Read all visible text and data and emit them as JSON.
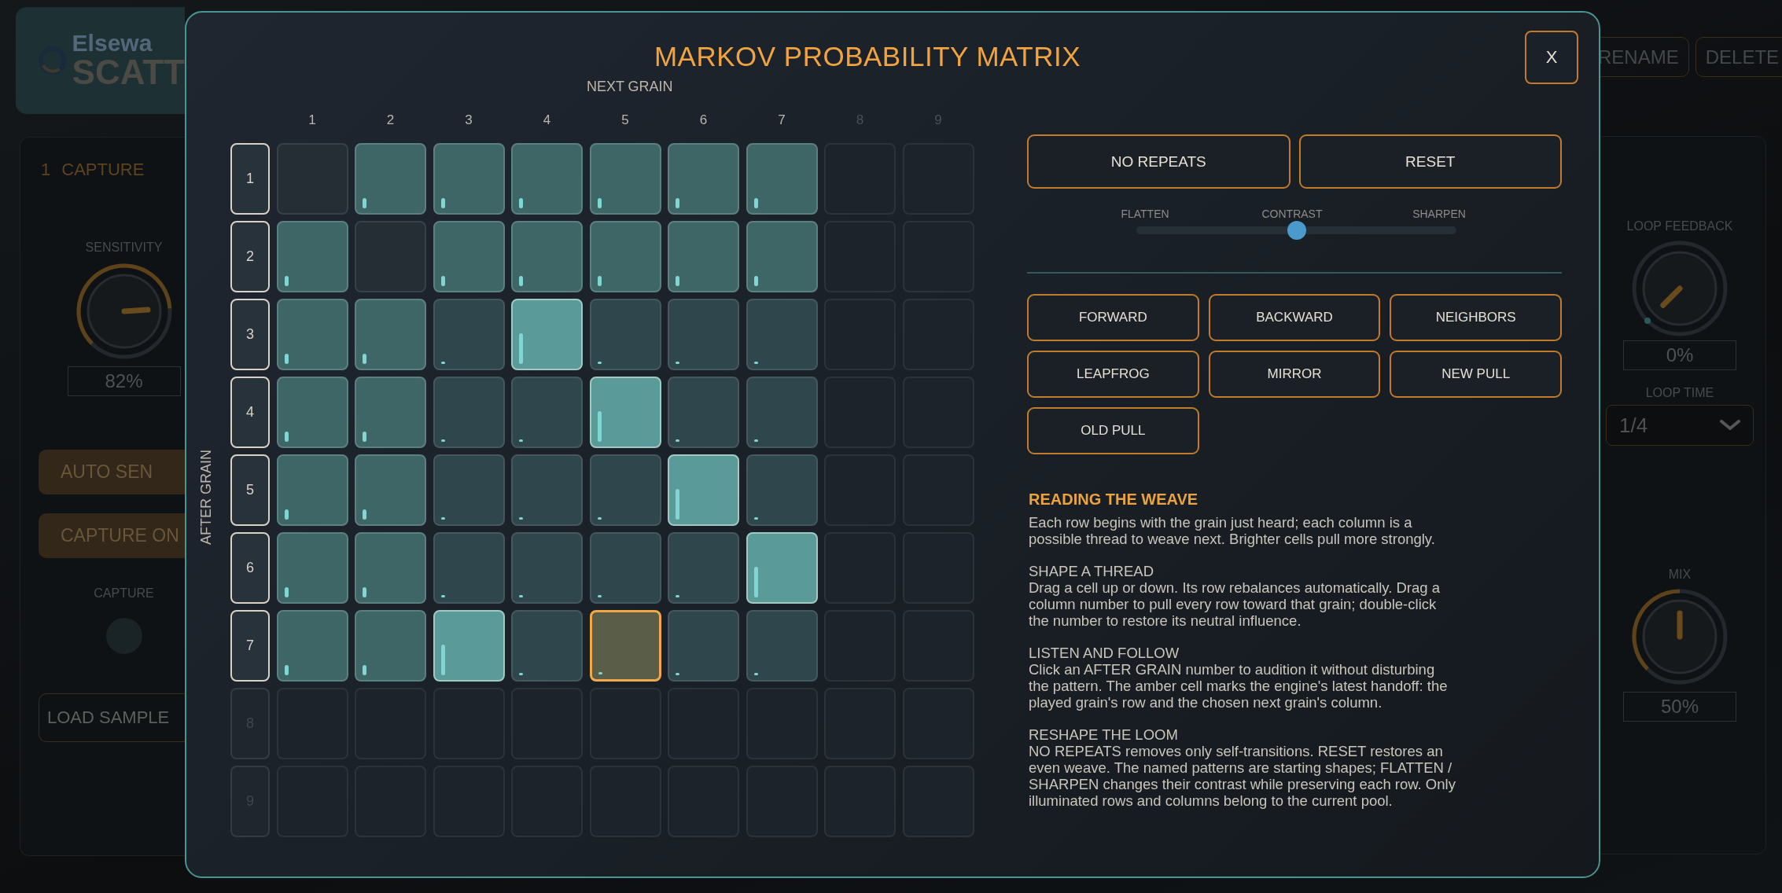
{
  "background_app": {
    "logo": {
      "line_1": "Elsewa",
      "line_2": "SCATT"
    },
    "capture_panel": {
      "number": "1",
      "title": "CAPTURE",
      "sensitivity": {
        "label": "SENSITIVITY",
        "reading": "82%"
      },
      "buttons": [
        "AUTO SEN",
        "CAPTURE ON"
      ],
      "indicator": {
        "label": "CAPTURE",
        "on": false
      },
      "load_button": "LOAD SAMPLE"
    },
    "header_buttons": [
      "RENAME",
      "DELETE"
    ],
    "loop_panel": {
      "loop_feedback": {
        "label": "LOOP FEEDBACK",
        "reading": "0%"
      },
      "loop_time": {
        "label": "LOOP TIME",
        "value": "1/4"
      },
      "mix": {
        "label": "MIX",
        "reading": "50%"
      }
    }
  },
  "modal": {
    "title": "MARKOV PROBABILITY MATRIX",
    "close": "X",
    "x_axis_label": "NEXT GRAIN",
    "y_axis_label": "AFTER GRAIN",
    "columns": [
      {
        "label": "1",
        "active": true
      },
      {
        "label": "2",
        "active": true
      },
      {
        "label": "3",
        "active": true
      },
      {
        "label": "4",
        "active": true
      },
      {
        "label": "5",
        "active": true
      },
      {
        "label": "6",
        "active": true
      },
      {
        "label": "7",
        "active": true
      },
      {
        "label": "8",
        "active": false
      },
      {
        "label": "9",
        "active": false
      }
    ],
    "rows": [
      {
        "label": "1",
        "active": true,
        "cells": [
          {
            "kind": "none",
            "selected": false
          },
          {
            "kind": "medium",
            "selected": false
          },
          {
            "kind": "medium",
            "selected": false
          },
          {
            "kind": "medium",
            "selected": false
          },
          {
            "kind": "medium",
            "selected": false
          },
          {
            "kind": "medium",
            "selected": false
          },
          {
            "kind": "medium",
            "selected": false
          },
          {
            "selected": false
          },
          {
            "selected": false
          }
        ]
      },
      {
        "label": "2",
        "active": true,
        "cells": [
          {
            "kind": "medium",
            "selected": false
          },
          {
            "kind": "none",
            "selected": false
          },
          {
            "kind": "medium",
            "selected": false
          },
          {
            "kind": "medium",
            "selected": false
          },
          {
            "kind": "medium",
            "selected": false
          },
          {
            "kind": "medium",
            "selected": false
          },
          {
            "kind": "medium",
            "selected": false
          },
          {
            "selected": false
          },
          {
            "selected": false
          }
        ]
      },
      {
        "label": "3",
        "active": true,
        "cells": [
          {
            "kind": "medium",
            "selected": false
          },
          {
            "kind": "medium",
            "selected": false
          },
          {
            "kind": "weak",
            "selected": false
          },
          {
            "kind": "strong",
            "selected": false
          },
          {
            "kind": "weak",
            "selected": false
          },
          {
            "kind": "weak",
            "selected": false
          },
          {
            "kind": "weak",
            "selected": false
          },
          {
            "selected": false
          },
          {
            "selected": false
          }
        ]
      },
      {
        "label": "4",
        "active": true,
        "cells": [
          {
            "kind": "medium",
            "selected": false
          },
          {
            "kind": "medium",
            "selected": false
          },
          {
            "kind": "weak",
            "selected": false
          },
          {
            "kind": "weak",
            "selected": false
          },
          {
            "kind": "strong",
            "selected": false
          },
          {
            "kind": "weak",
            "selected": false
          },
          {
            "kind": "weak",
            "selected": false
          },
          {
            "selected": false
          },
          {
            "selected": false
          }
        ]
      },
      {
        "label": "5",
        "active": true,
        "cells": [
          {
            "kind": "medium",
            "selected": false
          },
          {
            "kind": "medium",
            "selected": false
          },
          {
            "kind": "weak",
            "selected": false
          },
          {
            "kind": "weak",
            "selected": false
          },
          {
            "kind": "weak",
            "selected": false
          },
          {
            "kind": "strong",
            "selected": false
          },
          {
            "kind": "weak",
            "selected": false
          },
          {
            "selected": false
          },
          {
            "selected": false
          }
        ]
      },
      {
        "label": "6",
        "active": true,
        "cells": [
          {
            "kind": "medium",
            "selected": false
          },
          {
            "kind": "medium",
            "selected": false
          },
          {
            "kind": "weak",
            "selected": false
          },
          {
            "kind": "weak",
            "selected": false
          },
          {
            "kind": "weak",
            "selected": false
          },
          {
            "kind": "weak",
            "selected": false
          },
          {
            "kind": "strong",
            "selected": false
          },
          {
            "selected": false
          },
          {
            "selected": false
          }
        ]
      },
      {
        "label": "7",
        "active": true,
        "cells": [
          {
            "kind": "medium",
            "selected": false
          },
          {
            "kind": "medium",
            "selected": false
          },
          {
            "kind": "strong",
            "selected": false
          },
          {
            "kind": "weak",
            "selected": false
          },
          {
            "kind": "weak",
            "selected": true
          },
          {
            "kind": "weak",
            "selected": false
          },
          {
            "kind": "weak",
            "selected": false
          },
          {
            "selected": false
          },
          {
            "selected": false
          }
        ]
      },
      {
        "label": "8",
        "active": false,
        "cells": [
          {
            "selected": false
          },
          {
            "selected": false
          },
          {
            "selected": false
          },
          {
            "selected": false
          },
          {
            "selected": false
          },
          {
            "selected": false
          },
          {
            "selected": false
          },
          {
            "selected": false
          },
          {
            "selected": false
          }
        ]
      },
      {
        "label": "9",
        "active": false,
        "cells": [
          {
            "selected": false
          },
          {
            "selected": false
          },
          {
            "selected": false
          },
          {
            "selected": false
          },
          {
            "selected": false
          },
          {
            "selected": false
          },
          {
            "selected": false
          },
          {
            "selected": false
          },
          {
            "selected": false
          }
        ]
      }
    ],
    "actions": [
      "NO REPEATS",
      "RESET"
    ],
    "contrast": {
      "labels": [
        "FLATTEN",
        "CONTRAST",
        "SHARPEN"
      ],
      "level": 0.5
    },
    "patterns": [
      "FORWARD",
      "BACKWARD",
      "NEIGHBORS",
      "LEAPFROG",
      "MIRROR",
      "NEW PULL",
      "OLD PULL"
    ],
    "help": {
      "heading": "READING THE WEAVE",
      "intro": "Each row begins with the grain just heard; each column is a possible thread to weave next. Brighter cells pull more strongly.",
      "sections": [
        {
          "title": "SHAPE A THREAD",
          "text": "Drag a cell up or down. Its row rebalances automatically. Drag a column number to pull every row toward that grain; double-click the number to restore its neutral influence."
        },
        {
          "title": "LISTEN AND FOLLOW",
          "text": "Click an AFTER GRAIN number to audition it without disturbing the pattern. The amber cell marks the engine's latest handoff: the played grain's row and the chosen next grain's column."
        },
        {
          "title": "RESHAPE THE LOOM",
          "text": "NO REPEATS removes only self-transitions. RESET restores an even weave. The named patterns are starting shapes; FLATTEN / SHARPEN changes their contrast while preserving each row. Only illuminated rows and columns belong to the current pool."
        }
      ]
    }
  }
}
